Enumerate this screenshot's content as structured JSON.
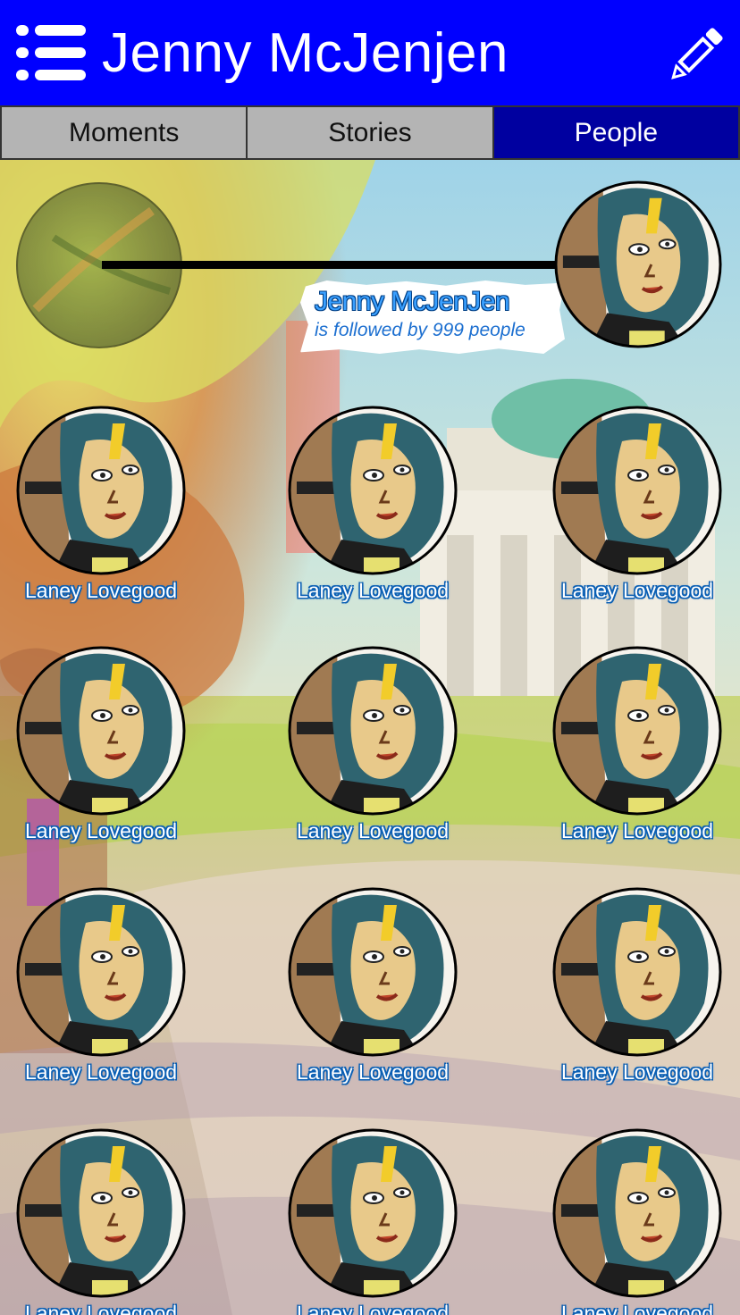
{
  "header": {
    "title": "Jenny McJenjen",
    "menu_icon": "hamburger-menu-icon",
    "edit_icon": "pencil-edit-icon",
    "background_color": "#0000ff"
  },
  "tabs": [
    {
      "label": "Moments",
      "active": false
    },
    {
      "label": "Stories",
      "active": false
    },
    {
      "label": "People",
      "active": true
    }
  ],
  "profile": {
    "name": "Jenny McJenJen",
    "subtitle": "is followed by 999 people"
  },
  "people": [
    {
      "name": "Laney Lovegood"
    },
    {
      "name": "Laney Lovegood"
    },
    {
      "name": "Laney Lovegood"
    },
    {
      "name": "Laney Lovegood"
    },
    {
      "name": "Laney Lovegood"
    },
    {
      "name": "Laney Lovegood"
    },
    {
      "name": "Laney Lovegood"
    },
    {
      "name": "Laney Lovegood"
    },
    {
      "name": "Laney Lovegood"
    },
    {
      "name": "Laney Lovegood"
    },
    {
      "name": "Laney Lovegood"
    },
    {
      "name": "Laney Lovegood"
    }
  ],
  "colors": {
    "accent": "#0000ff",
    "active_tab": "#0000a0",
    "inactive_tab": "#b4b4b4",
    "name_label_outline": "#0a5fb4"
  }
}
